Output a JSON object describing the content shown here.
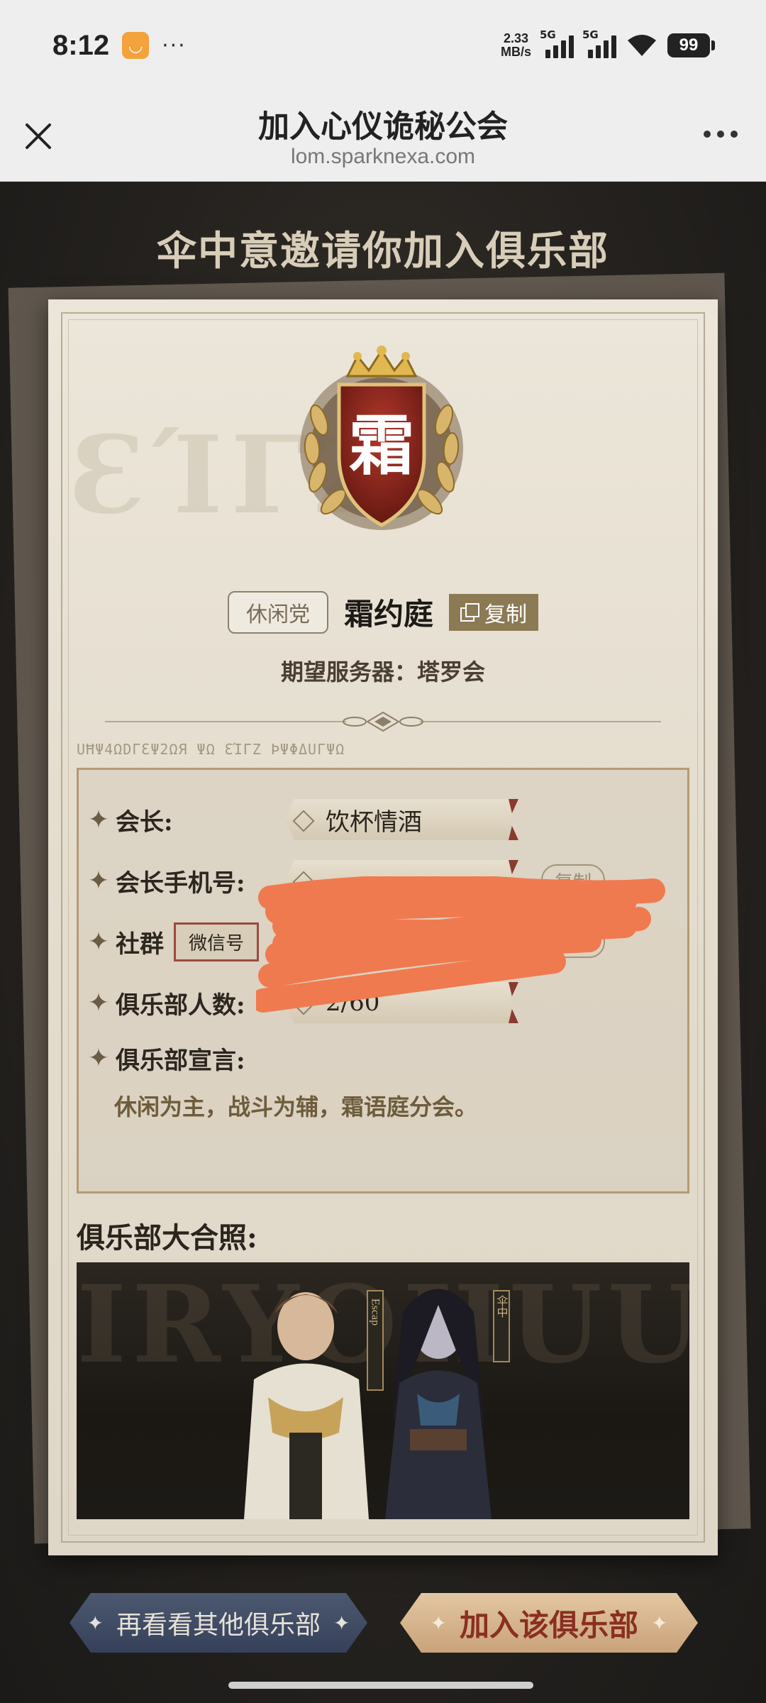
{
  "status_bar": {
    "time": "8:12",
    "net_speed_value": "2.33",
    "net_speed_unit": "MB/s",
    "sim1_tag": "5G",
    "sim2_tag": "5G",
    "battery": "99"
  },
  "browser": {
    "title": "加入心仪诡秘公会",
    "url": "lom.sparknexa.com"
  },
  "invite": {
    "title": "伞中意邀请你加入俱乐部"
  },
  "club": {
    "emblem_char": "霜",
    "type_tag": "休闲党",
    "name": "霜约庭",
    "copy_label": "复制",
    "server_line": "期望服务器：塔罗会",
    "cipher_line": "UĦΨ4ΩDΓƐΨ2ΩЯ ΨΩ ƐΊΓZ ÞΨΦΔUΓΨΩ"
  },
  "info": {
    "leader_label": "会长:",
    "leader_value": "饮杯情酒",
    "phone_label": "会长手机号:",
    "community_label": "社群",
    "wechat_tag": "微信号",
    "copy_small": "复制",
    "members_label": "俱乐部人数:",
    "members_value": "2/60",
    "manifesto_label": "俱乐部宣言:",
    "manifesto_text": "休闲为主，战斗为辅，霜语庭分会。"
  },
  "photo": {
    "title": "俱乐部大合照:",
    "banner_left": "Escap",
    "banner_right": "伞中"
  },
  "buttons": {
    "other_label": "再看看其他俱乐部",
    "join_label": "加入该俱乐部"
  },
  "colors": {
    "accent_red": "#8a2f22",
    "button_blue": "#3f4a64",
    "button_gold": "#d8b48c"
  }
}
